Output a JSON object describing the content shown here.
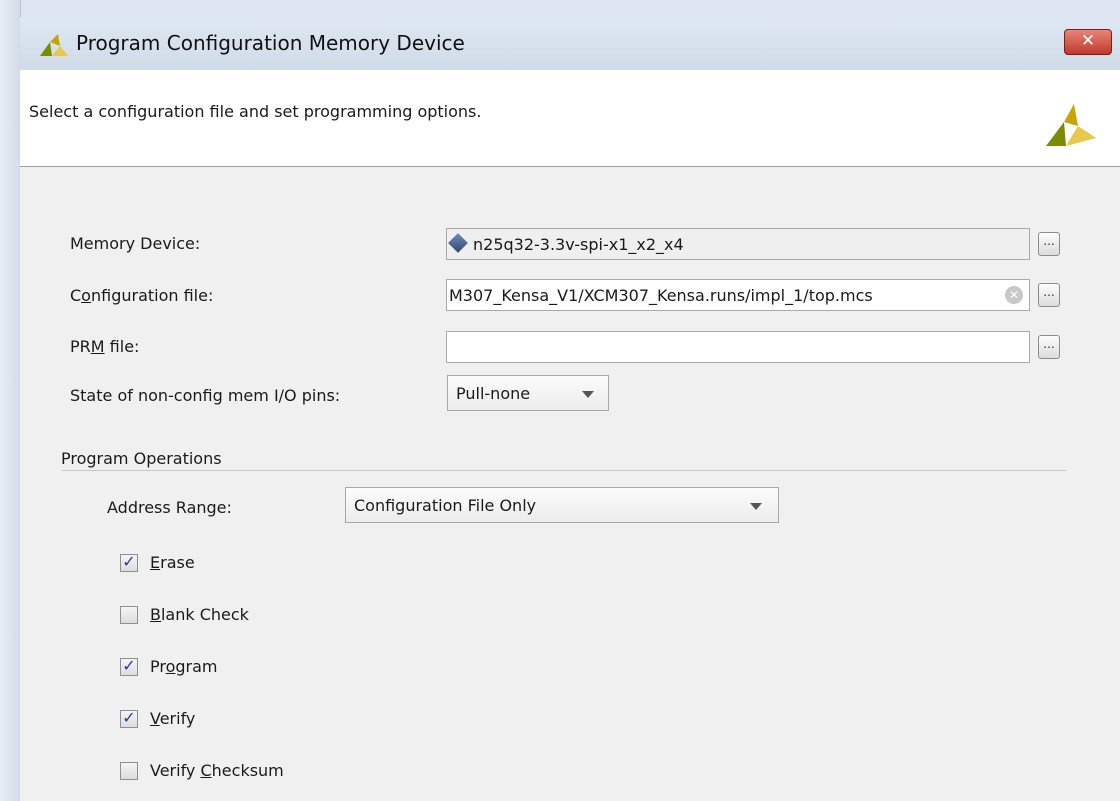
{
  "window": {
    "title": "Program Configuration Memory Device",
    "close_label": "✕"
  },
  "banner": {
    "text": "Select a configuration file and set programming options."
  },
  "form": {
    "memory_device": {
      "label": "Memory Device:",
      "value": "n25q32-3.3v-spi-x1_x2_x4",
      "browse_label": "..."
    },
    "configuration_file": {
      "label_pre": "C",
      "label_u": "o",
      "label_post": "nfiguration file:",
      "value": "M307_Kensa_V1/XCM307_Kensa.runs/impl_1/top.mcs",
      "browse_label": "..."
    },
    "prm_file": {
      "label_pre": "PR",
      "label_u": "M",
      "label_post": " file:",
      "value": "",
      "browse_label": "..."
    },
    "io_pins": {
      "label": "State of non-config mem I/O pins:",
      "value": "Pull-none"
    }
  },
  "program_operations": {
    "heading": "Program Operations",
    "address_range": {
      "label": "Address Range:",
      "value": "Configuration File Only"
    },
    "options": [
      {
        "u": "E",
        "rest": "rase",
        "pre": "",
        "checked": true
      },
      {
        "u": "B",
        "rest": "lank Check",
        "pre": "",
        "checked": false
      },
      {
        "pre": "Pr",
        "u": "o",
        "rest": "gram",
        "checked": true
      },
      {
        "u": "V",
        "rest": "erify",
        "pre": "",
        "checked": true
      },
      {
        "pre": "Verify ",
        "u": "C",
        "rest": "hecksum",
        "checked": false
      }
    ]
  },
  "colors": {
    "logo_dark": "#7a8c00",
    "logo_light": "#e8c74a",
    "close": "#c0392b"
  }
}
